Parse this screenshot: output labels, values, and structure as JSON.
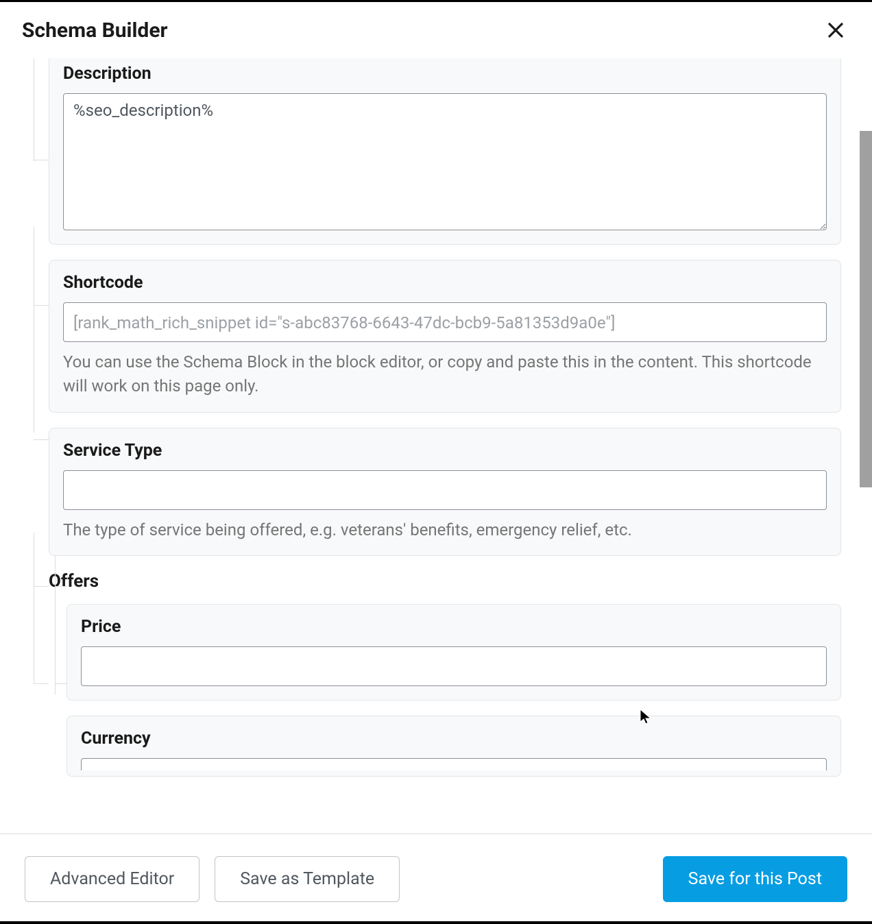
{
  "header": {
    "title": "Schema Builder"
  },
  "fields": {
    "description": {
      "label": "Description",
      "value": "%seo_description%"
    },
    "shortcode": {
      "label": "Shortcode",
      "value": "[rank_math_rich_snippet id=\"s-abc83768-6643-47dc-bcb9-5a81353d9a0e\"]",
      "help": "You can use the Schema Block in the block editor, or copy and paste this in the content. This shortcode will work on this page only."
    },
    "service_type": {
      "label": "Service Type",
      "value": "",
      "help": "The type of service being offered, e.g. veterans' benefits, emergency relief, etc."
    },
    "offers": {
      "label": "Offers",
      "price": {
        "label": "Price",
        "value": ""
      },
      "currency": {
        "label": "Currency",
        "value": ""
      }
    }
  },
  "footer": {
    "advanced_editor": "Advanced Editor",
    "save_template": "Save as Template",
    "save_post": "Save for this Post"
  }
}
